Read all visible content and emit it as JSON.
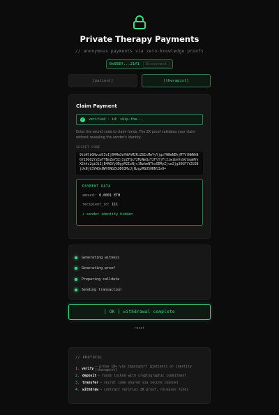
{
  "header": {
    "title": "Private Therapy Payments",
    "subtitle": "// anonymous payments via zero-knowledge proofs",
    "wallet_address": "0x95Ef...21f1",
    "disconnect_label": "Disconnect"
  },
  "tabs": [
    {
      "label": "[patient]",
      "active": false
    },
    {
      "label": "[therapist]",
      "active": true
    }
  ],
  "claim": {
    "title": "Claim Payment",
    "verified_text": "verified · id: skip-the...",
    "description": "Enter the secret code to claim funds. The ZK proof validates your claim without revealing the sender's identity.",
    "secret_label": "SECRET CODE",
    "secret_value": "9tbHlbGNvudCIoIjB4MmIwYWVhM2RiZGIxMmYyYjgzYWNmNDhjMTVlNWNhNGY1OGQ2YzEwYTBmZmY3ZjIyZTQxY2MzNmQzY2FlYjFlIiwibnVsbGlmaWVyX2hhc2giOiIjB4NGYyODgyM2IzNjc1NzhmNTkxODMyZjcwZjg3OGFlY2U2NjUxNjU3YWQxNWY0NGZkODQ3MzJjNzgzMGU5ODNlIn0=",
    "payment_title": "PAYMENT DATA",
    "amount_label": "amount:",
    "amount_value": "0.0001 ETH",
    "recipient_label": "recipient_id:",
    "recipient_value": "111",
    "hidden_text": "+ sender identity hidden"
  },
  "steps": [
    {
      "label": "Generating witness"
    },
    {
      "label": "Generating proof"
    },
    {
      "label": "Preparing calldata"
    },
    {
      "label": "Sending transaction"
    }
  ],
  "complete_label": "[ OK ] withdrawal complete",
  "reset_label": "reset",
  "protocol": {
    "title": "// PROTOCOL",
    "items": [
      {
        "num": "1.",
        "key": "verify",
        "desc": "— prove 18+ via zkpassport [patient] or identity [therapist]"
      },
      {
        "num": "2.",
        "key": "deposit",
        "desc": "— funds locked with cryptographic commitment"
      },
      {
        "num": "3.",
        "key": "transfer",
        "desc": "— secret code shared via secure channel"
      },
      {
        "num": "4.",
        "key": "withdraw",
        "desc": "— contract verifies ZK proof, releases funds"
      }
    ]
  },
  "colors": {
    "accent": "#3ddc84",
    "background": "#0c0c0c",
    "card": "#171717"
  }
}
